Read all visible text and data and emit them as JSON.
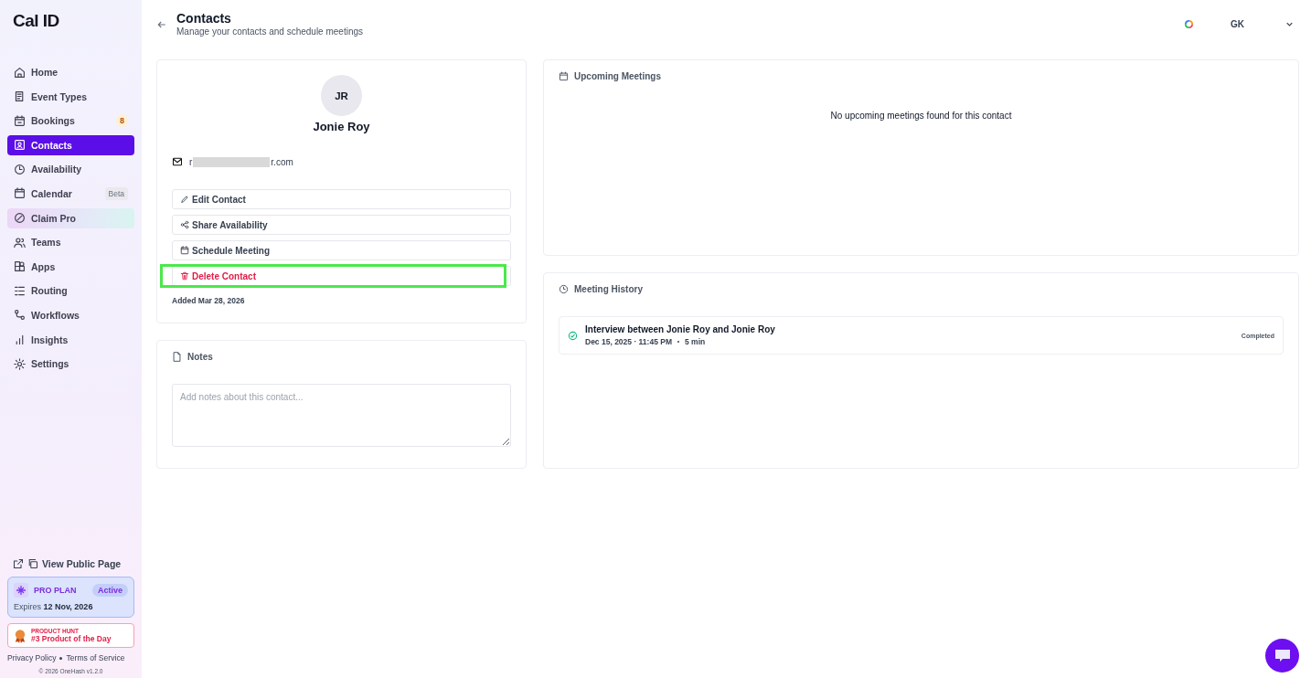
{
  "sidebar": {
    "logo": "Cal ID",
    "items": [
      {
        "label": "Home",
        "selected": false
      },
      {
        "label": "Event Types",
        "selected": false
      },
      {
        "label": "Bookings",
        "selected": false,
        "badge": "8"
      },
      {
        "label": "Contacts",
        "selected": true
      },
      {
        "label": "Availability",
        "selected": false
      },
      {
        "label": "Calendar",
        "selected": false,
        "tag": "Beta"
      },
      {
        "label": "Claim Pro",
        "selected": false,
        "kind": "promo"
      },
      {
        "label": "Teams",
        "selected": false
      },
      {
        "label": "Apps",
        "selected": false
      },
      {
        "label": "Routing",
        "selected": false
      },
      {
        "label": "Workflows",
        "selected": false
      },
      {
        "label": "Insights",
        "selected": false
      },
      {
        "label": "Settings",
        "selected": false
      }
    ],
    "public_page": "View Public Page",
    "plan": {
      "name": "PRO PLAN",
      "status": "Active",
      "expires_label": "Expires",
      "expires_date": "12 Nov, 2026"
    },
    "award": {
      "source": "PRODUCT HUNT",
      "title": "#3 Product of the Day"
    },
    "links": [
      "Privacy Policy",
      "Terms of Service"
    ],
    "footer": "© 2026 OneHash v1.2.0"
  },
  "header": {
    "title": "Contacts",
    "subtitle": "Manage your contacts and schedule meetings",
    "user": "GK"
  },
  "contact": {
    "initials": "JR",
    "name": "Jonie Roy",
    "email_start": "r",
    "email_end": "r.com",
    "added": "Added Mar 28, 2026",
    "actions": [
      {
        "label": "Edit Contact",
        "kind": "edit",
        "highlighted": false
      },
      {
        "label": "Share Availability",
        "kind": "share",
        "highlighted": false
      },
      {
        "label": "Schedule Meeting",
        "kind": "schedule",
        "highlighted": false
      },
      {
        "label": "Delete Contact",
        "kind": "delete",
        "highlighted": true
      }
    ]
  },
  "notes": {
    "title": "Notes",
    "placeholder": "Add notes about this contact..."
  },
  "upcoming": {
    "title": "Upcoming Meetings",
    "empty": "No upcoming meetings found for this contact"
  },
  "history": {
    "title": "Meeting History",
    "meetings": [
      {
        "title": "Interview between Jonie Roy and Jonie Roy",
        "date": "Dec 15, 2025 · 11:45 PM",
        "duration": "5 min",
        "status": "Completed"
      }
    ]
  }
}
